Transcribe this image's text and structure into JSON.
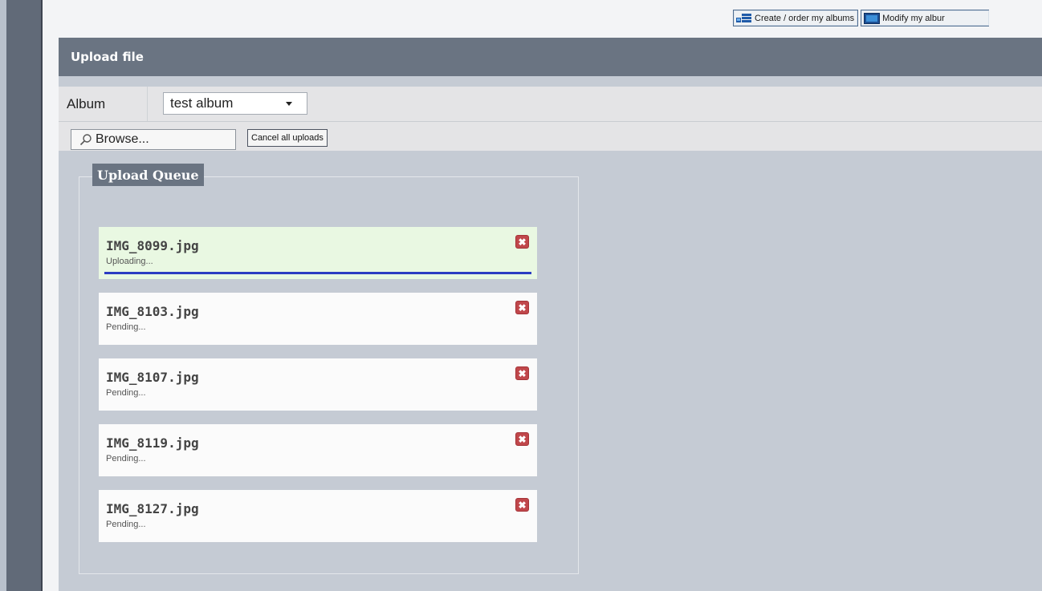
{
  "toolbar": {
    "create_label": "Create / order my albums",
    "modify_label": "Modify my albur"
  },
  "panel": {
    "title": "Upload file"
  },
  "album": {
    "label": "Album",
    "selected": "test album"
  },
  "actions": {
    "browse_label": "Browse...",
    "cancel_all_label": "Cancel all uploads"
  },
  "queue": {
    "legend": "Upload Queue",
    "remove_glyph": "✖",
    "items": [
      {
        "filename": "IMG_8099.jpg",
        "status": "Uploading...",
        "progress": 1.0
      },
      {
        "filename": "IMG_8103.jpg",
        "status": "Pending..."
      },
      {
        "filename": "IMG_8107.jpg",
        "status": "Pending..."
      },
      {
        "filename": "IMG_8119.jpg",
        "status": "Pending..."
      },
      {
        "filename": "IMG_8127.jpg",
        "status": "Pending..."
      }
    ]
  },
  "colors": {
    "header_bg": "#6a7482",
    "panel_bg": "#c5cbd4",
    "uploading_bg": "#e9f8e2",
    "progress": "#2b3cc2",
    "remove_red": "#c0474b"
  }
}
